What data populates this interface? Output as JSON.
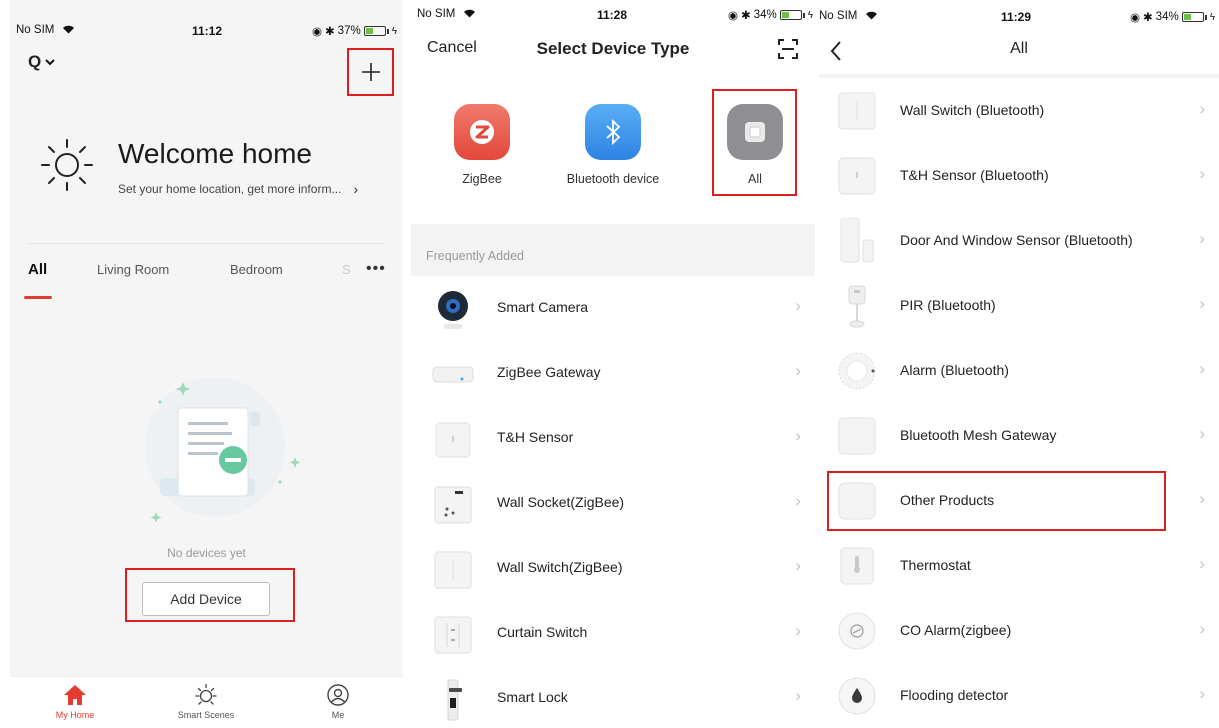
{
  "panel1": {
    "status": {
      "carrier": "No SIM",
      "time": "11:12",
      "battery": "37%"
    },
    "home_switch": "Q",
    "welcome": {
      "title": "Welcome home",
      "subtitle": "Set your home location, get more inform..."
    },
    "tabs": [
      "All",
      "Living Room",
      "Bedroom"
    ],
    "tab_faded": "S",
    "empty_text": "No devices yet",
    "add_device_label": "Add Device",
    "nav": [
      "My Home",
      "Smart Scenes",
      "Me"
    ]
  },
  "panel2": {
    "status": {
      "carrier": "No SIM",
      "time": "11:28",
      "battery": "34%"
    },
    "cancel_label": "Cancel",
    "title": "Select Device Type",
    "categories": [
      {
        "label": "ZigBee"
      },
      {
        "label": "Bluetooth device"
      },
      {
        "label": "All"
      }
    ],
    "section_label": "Frequently Added",
    "items": [
      {
        "label": "Smart Camera"
      },
      {
        "label": "ZigBee Gateway"
      },
      {
        "label": "T&H Sensor"
      },
      {
        "label": "Wall Socket(ZigBee)"
      },
      {
        "label": "Wall Switch(ZigBee)"
      },
      {
        "label": "Curtain Switch"
      },
      {
        "label": "Smart Lock"
      }
    ]
  },
  "panel3": {
    "status": {
      "carrier": "No SIM",
      "time": "11:29",
      "battery": "34%"
    },
    "title": "All",
    "items": [
      {
        "label": "Wall Switch (Bluetooth)"
      },
      {
        "label": "T&H Sensor (Bluetooth)"
      },
      {
        "label": "Door And Window Sensor (Bluetooth)"
      },
      {
        "label": "PIR (Bluetooth)"
      },
      {
        "label": "Alarm (Bluetooth)"
      },
      {
        "label": "Bluetooth Mesh Gateway"
      },
      {
        "label": "Other Products"
      },
      {
        "label": "Thermostat"
      },
      {
        "label": "CO Alarm(zigbee)"
      },
      {
        "label": "Flooding detector"
      }
    ]
  },
  "colors": {
    "highlight": "#d9201c",
    "accent": "#e53a2f",
    "battery_fill": "#6cc04a"
  }
}
